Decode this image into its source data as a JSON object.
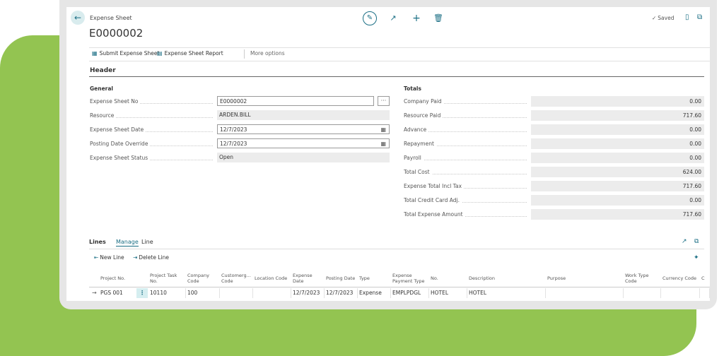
{
  "page": {
    "caption": "Expense Sheet",
    "title": "E0000002",
    "saved": "Saved"
  },
  "actions": {
    "submit": "Submit Expense Sheet",
    "report": "Expense Sheet Report",
    "more": "More options"
  },
  "header": {
    "title": "Header",
    "general_title": "General",
    "totals_title": "Totals"
  },
  "general": [
    {
      "label": "Expense Sheet No",
      "value": "E0000002"
    },
    {
      "label": "Resource",
      "value": "ARDEN.BILL"
    },
    {
      "label": "Expense Sheet Date",
      "value": "12/7/2023"
    },
    {
      "label": "Posting Date Override",
      "value": "12/7/2023"
    },
    {
      "label": "Expense Sheet Status",
      "value": "Open"
    }
  ],
  "totals": [
    {
      "label": "Company Paid",
      "value": "0.00"
    },
    {
      "label": "Resource Paid",
      "value": "717.60"
    },
    {
      "label": "Advance",
      "value": "0.00"
    },
    {
      "label": "Repayment",
      "value": "0.00"
    },
    {
      "label": "Payroll",
      "value": "0.00"
    },
    {
      "label": "Total Cost",
      "value": "624.00"
    },
    {
      "label": "Expense Total Incl Tax",
      "value": "717.60"
    },
    {
      "label": "Total Credit Card Adj.",
      "value": "0.00"
    },
    {
      "label": "Total Expense Amount",
      "value": "717.60"
    }
  ],
  "lines": {
    "title": "Lines",
    "tabs": [
      "Manage",
      "Line"
    ],
    "new_line": "New Line",
    "delete_line": "Delete Line",
    "columns": [
      "Project No.",
      "Project Task No.",
      "Company Code",
      "Customerg... Code",
      "Location Code",
      "Expense Date",
      "Posting Date",
      "Type",
      "Expense Payment Type",
      "No.",
      "Description",
      "Purpose",
      "Work Type Code",
      "Currency Code",
      "C"
    ],
    "rows": [
      [
        "PGS 001",
        "10110",
        "100",
        "",
        "",
        "12/7/2023",
        "12/7/2023",
        "Expense",
        "EMPLPDGL",
        "HOTEL",
        "HOTEL",
        "",
        "",
        "",
        ""
      ]
    ]
  },
  "icons": {
    "back": "back-arrow-icon",
    "edit": "pencil-icon",
    "share": "share-icon",
    "new": "plus-icon",
    "delete": "trash-icon",
    "bookmark": "bookmark-icon",
    "popout": "popout-icon"
  },
  "colors": {
    "accent": "#1b6f85",
    "background_shape": "#93c451"
  }
}
